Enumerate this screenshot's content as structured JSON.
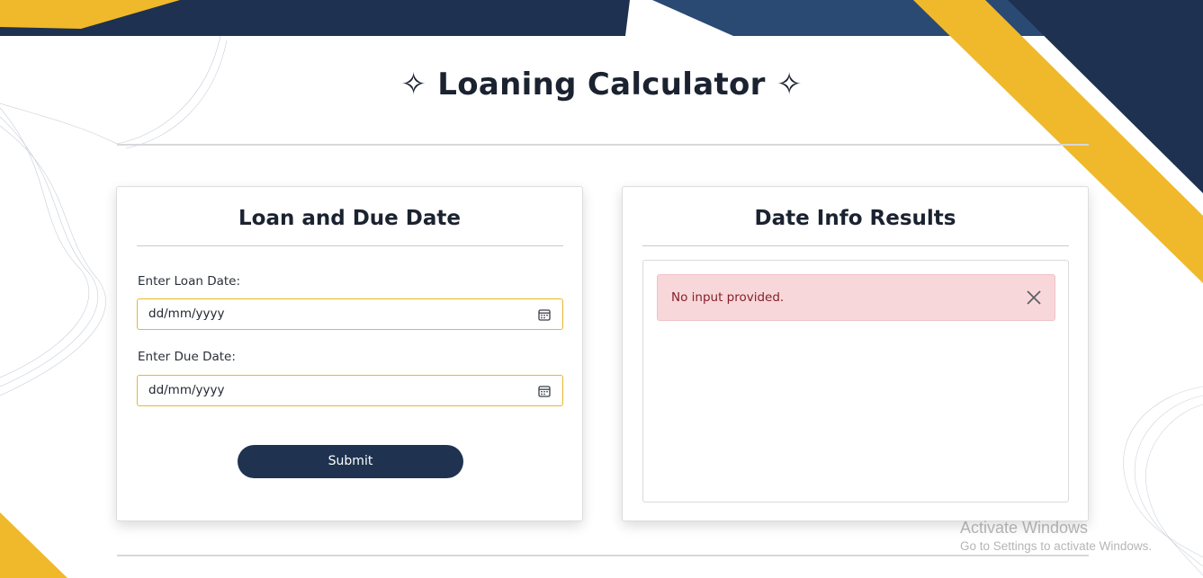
{
  "header": {
    "title": "✧ Loaning Calculator ✧"
  },
  "input_card": {
    "title": "Loan and Due Date",
    "loan_date": {
      "label": "Enter Loan Date:",
      "placeholder": "dd/mm/yyyy"
    },
    "due_date": {
      "label": "Enter Due Date:",
      "placeholder": "dd/mm/yyyy"
    },
    "submit_label": "Submit"
  },
  "results_card": {
    "title": "Date Info Results",
    "alert": {
      "message": "No input provided.",
      "close_icon": "close-icon"
    }
  },
  "watermark": {
    "line1": "Activate Windows",
    "line2": "Go to Settings to activate Windows."
  },
  "colors": {
    "navy": "#1f3350",
    "gold": "#efb92b",
    "alert_bg": "#f8d7da",
    "alert_text": "#842029",
    "input_border": "#e6b82c"
  }
}
